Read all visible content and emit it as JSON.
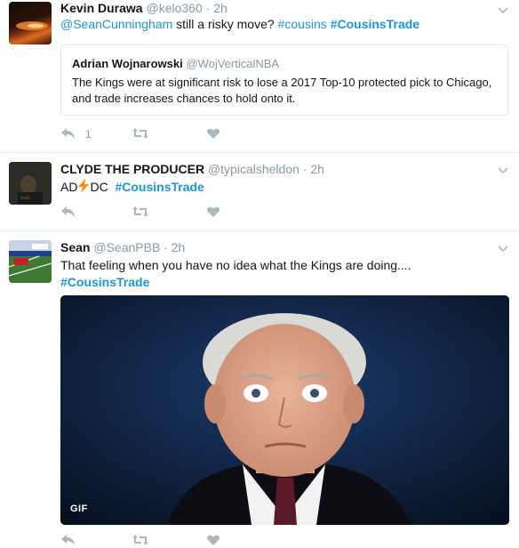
{
  "tweets": [
    {
      "name": "Kevin Durawa",
      "handle": "@kelo360",
      "dot": "·",
      "time": "2h",
      "mention": "@SeanCunningham",
      "text_mid": " still a risky move? ",
      "tag1": "#cousins",
      "tag2": "#CousinsTrade",
      "reply_count": "1",
      "quote": {
        "name": "Adrian Wojnarowski",
        "handle": "@WojVerticalNBA",
        "text": "The Kings were at significant risk to lose a 2017 Top-10 protected pick to Chicago, and trade increases chances to hold onto it."
      }
    },
    {
      "name": "CLYDE THE PRODUCER",
      "handle": "@typicalsheldon",
      "dot": "·",
      "time": "2h",
      "text_a": "AD",
      "text_b": "DC",
      "tag": "#CousinsTrade"
    },
    {
      "name": "Sean",
      "handle": "@SeanPBB",
      "dot": "·",
      "time": "2h",
      "text": "That feeling when you have no idea what the Kings are doing....",
      "tag": "#CousinsTrade",
      "gif_badge": "GIF"
    }
  ],
  "icons": [
    "reply-icon",
    "retweet-icon",
    "like-icon",
    "chevron-down-icon",
    "lightning-emoji-icon"
  ],
  "colors": {
    "link": "#1b95e0",
    "muted": "#8899a6",
    "divider": "#e6ecf0",
    "lightning": "#f4900c"
  }
}
